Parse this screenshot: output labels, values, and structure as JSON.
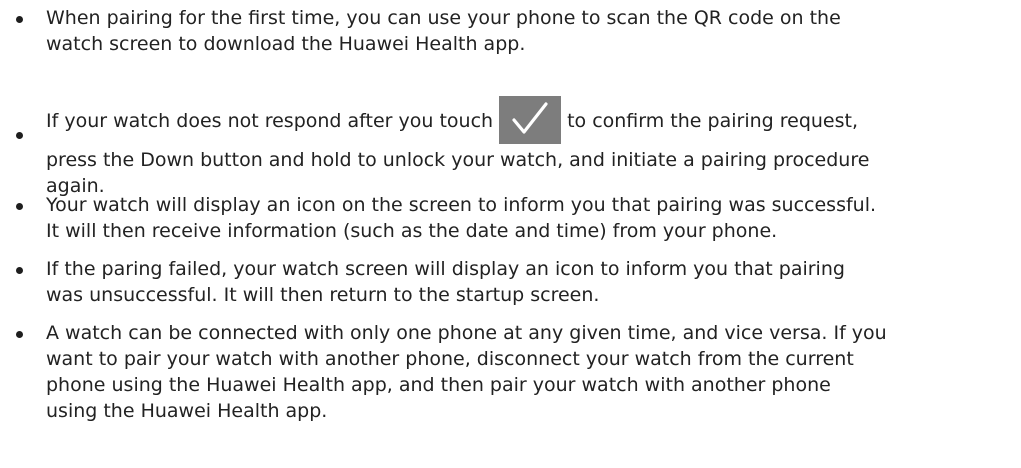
{
  "document": {
    "bullets": [
      {
        "lines": [
          "When pairing for the first time, you can use your phone to scan the QR code on the",
          "watch screen to download the Huawei Health app."
        ]
      },
      {
        "before_icon": "If your watch does not respond after you touch",
        "icon": "checkmark-icon",
        "after_icon": "to confirm the pairing request,",
        "lines": [
          "press the Down button and hold to unlock your watch, and initiate a pairing procedure",
          "again."
        ]
      },
      {
        "lines": [
          "Your watch will display an icon on the screen to inform you that pairing was successful.",
          "It will then receive information (such as the date and time) from your phone."
        ]
      },
      {
        "lines": [
          "If the paring failed, your watch screen will display an icon to inform you that pairing",
          "was unsuccessful. It will then return to the startup screen."
        ]
      },
      {
        "lines": [
          "A watch can be connected with only one phone at any given time, and vice versa. If you",
          "want to pair your watch with another phone, disconnect your watch from the current",
          "phone using the Huawei Health app, and then pair your watch with another phone",
          "using the Huawei Health app."
        ]
      }
    ],
    "colors": {
      "text": "#222222",
      "icon_background": "#7d7d7d",
      "icon_check": "#ffffff"
    }
  }
}
